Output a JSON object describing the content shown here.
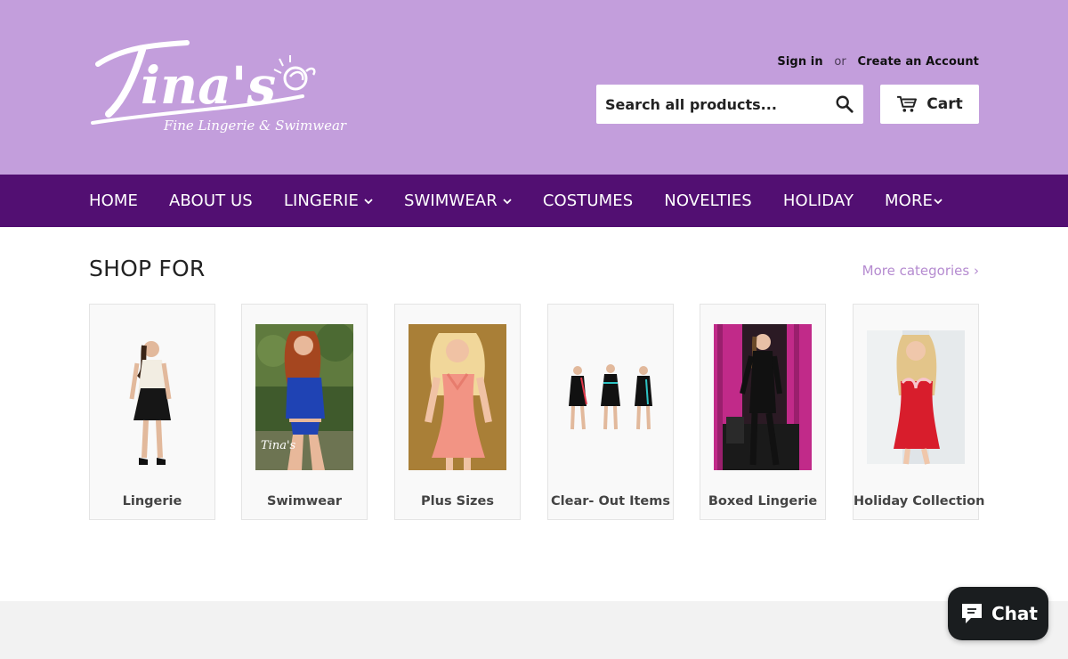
{
  "header": {
    "logo_text": "Tina's",
    "logo_tagline": "Fine Lingerie & Swimwear",
    "sign_in": "Sign in",
    "or": "or",
    "create_account": "Create an Account",
    "search_placeholder": "Search all products...",
    "search_icon": "magnifier-icon",
    "cart_label": "Cart",
    "cart_icon": "shopping-cart-icon"
  },
  "nav": {
    "items": [
      {
        "label": "HOME"
      },
      {
        "label": "ABOUT US"
      },
      {
        "label": "LINGERIE"
      },
      {
        "label": "SWIMWEAR"
      },
      {
        "label": "COSTUMES"
      },
      {
        "label": "NOVELTIES"
      },
      {
        "label": "HOLIDAY"
      },
      {
        "label": "MORE"
      }
    ]
  },
  "main": {
    "title": "SHOP FOR",
    "more_link": "More categories ›",
    "categories": [
      {
        "label": "Lingerie"
      },
      {
        "label": "Swimwear"
      },
      {
        "label": "Plus Sizes"
      },
      {
        "label": "Clear- Out Items"
      },
      {
        "label": "Boxed Lingerie"
      },
      {
        "label": "Holiday Collection"
      }
    ]
  },
  "chat": {
    "label": "Chat",
    "icon": "chat-bubble-icon"
  },
  "colors": {
    "header_bg": "#c39edc",
    "nav_bg": "#520f72",
    "link": "#b58bd0",
    "chat_bg": "#1a1d1f"
  }
}
